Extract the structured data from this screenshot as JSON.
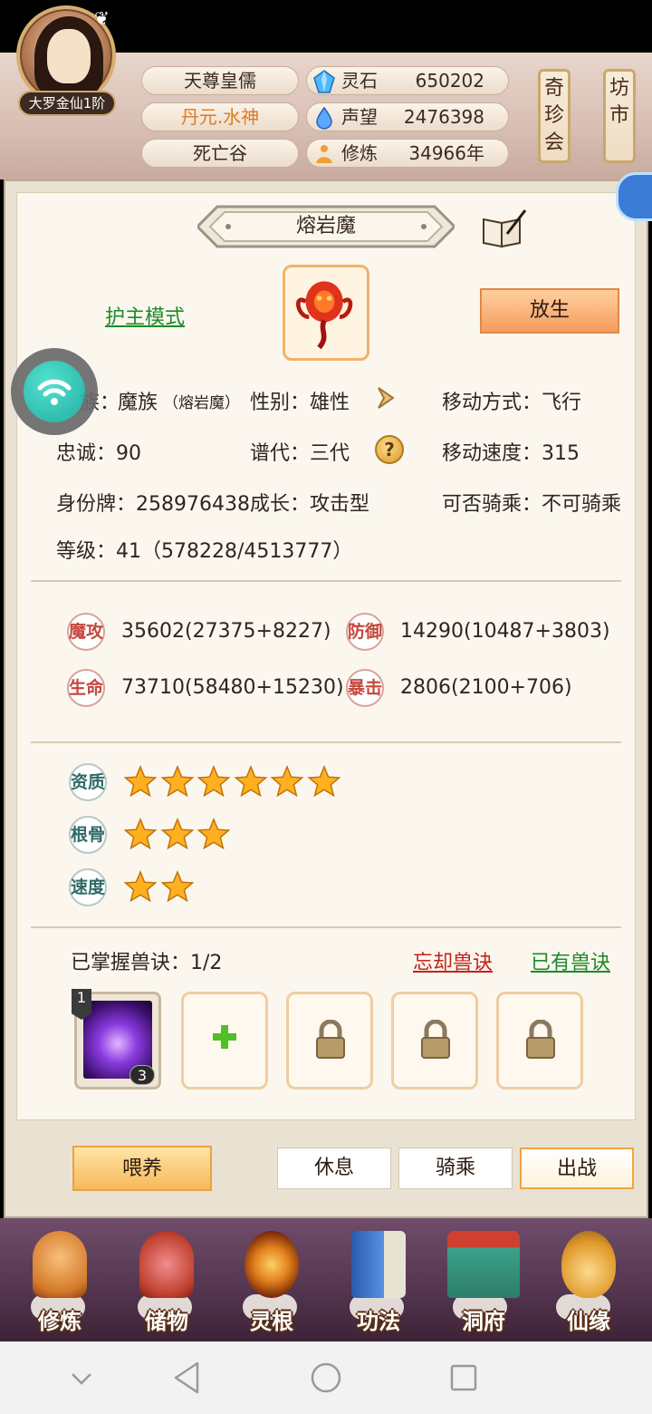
{
  "header": {
    "rank": "大罗金仙1阶",
    "title": "天尊皇儒",
    "faction": "丹元.水神",
    "location": "死亡谷",
    "resources": [
      {
        "label": "灵石",
        "value": "650202"
      },
      {
        "label": "声望",
        "value": "2476398"
      },
      {
        "label": "修炼",
        "value": "34966年"
      }
    ],
    "side_tags": [
      {
        "text": "奇珍会"
      },
      {
        "text": "坊市"
      }
    ]
  },
  "pet": {
    "name": "熔岩魔",
    "mode_link": "护主模式",
    "release_button": "放生",
    "race_label": "族：",
    "race_value": "魔族",
    "race_detail": "（熔岩魔）",
    "gender": "性别：雄性",
    "move_type": "移动方式：飞行",
    "loyalty": "忠诚：90",
    "generation": "谱代：三代",
    "move_speed": "移动速度：315",
    "id_tag": "身份牌：258976438",
    "growth": "成长：攻击型",
    "rideable": "可否骑乘：不可骑乘",
    "level": "等级：41（578228/4513777）"
  },
  "stats": [
    {
      "badge": "魔攻",
      "value": "35602(27375+8227)"
    },
    {
      "badge": "防御",
      "value": "14290(10487+3803)"
    },
    {
      "badge": "生命",
      "value": "73710(58480+15230)"
    },
    {
      "badge": "暴击",
      "value": "2806(2100+706)"
    }
  ],
  "qualities": [
    {
      "badge": "资质",
      "stars": 6
    },
    {
      "badge": "根骨",
      "stars": 3
    },
    {
      "badge": "速度",
      "stars": 2
    }
  ],
  "skills": {
    "mastered_label": "已掌握兽诀：1/2",
    "forget_link": "忘却兽诀",
    "owned_link": "已有兽诀",
    "owned_level": "1",
    "owned_count": "3"
  },
  "actions": {
    "feed": "喂养",
    "rest": "休息",
    "ride": "骑乘",
    "fight": "出战"
  },
  "nav": [
    {
      "label": "修炼",
      "icon": "monk-icon"
    },
    {
      "label": "储物",
      "icon": "bag-icon"
    },
    {
      "label": "灵根",
      "icon": "spirit-orb-icon"
    },
    {
      "label": "功法",
      "icon": "book-icon"
    },
    {
      "label": "洞府",
      "icon": "palace-icon"
    },
    {
      "label": "仙缘",
      "icon": "gourd-icon"
    }
  ],
  "colors": {
    "accent_orange": "#f59c5e",
    "link_green": "#1e8a2a",
    "link_red": "#c2241a",
    "faction_orange": "#e07a1e"
  }
}
